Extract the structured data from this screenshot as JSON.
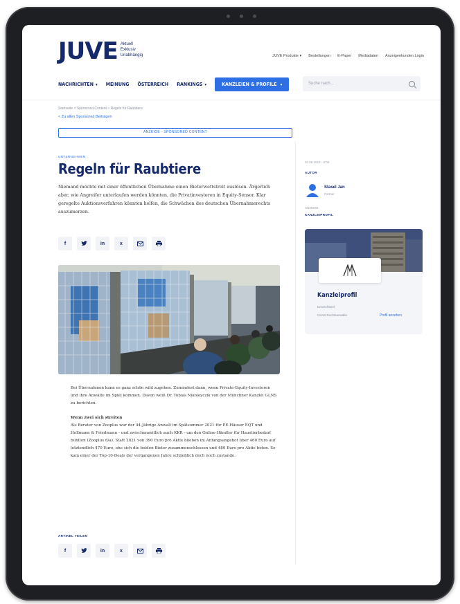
{
  "header": {
    "logo_text": "JUVE",
    "logo_sub": "Aktuell Exklusiv Unabhängig",
    "top_links": [
      "JUVE Produkte ▾",
      "Bestellungen",
      "E-Paper",
      "Mediadaten",
      "Anzeigenkunden Login"
    ],
    "nav": [
      {
        "label": "NACHRICHTEN",
        "has_menu": true
      },
      {
        "label": "MEINUNG",
        "has_menu": false
      },
      {
        "label": "ÖSTERREICH",
        "has_menu": false
      },
      {
        "label": "RANKINGS",
        "has_menu": true
      }
    ],
    "cta_label": "KANZLEIEN & PROFILE",
    "search_placeholder": "Suche nach..."
  },
  "article": {
    "breadcrumb": "Startseite > Sponsored Content > Regeln für Raubtiere",
    "back_link": "< Zu allen Sponsored Beiträgen",
    "sponsored_label": "ANZEIGE - SPONSORED CONTENT",
    "category": "UNTERNEHMEN",
    "title": "Regeln für Raubtiere",
    "lead": "Niemand möchte mit einer öffentlichen Übernahme einen Bieterwettstreit auslösen. Ärgerlich aber, wie Angreifer unterlaufen werden könnten, die Privatinvestoren in Equity-Sensor. Klar geregelte Auktionsverfahren könnten helfen, die Schwächen des deutschen Übernahmerechts auszumerzen.",
    "share_icons": [
      "f",
      "t",
      "in",
      "x",
      "mail",
      "print"
    ],
    "paragraph1": "Bei Übernahmen kann es ganz schön wild zugehen. Zumindest dann, wenn Private-Equity-Investoren und ihre Anwälte im Spiel kommen. Davon weiß Dr. Tobias Nikoleyczik von der Münchner Kanzlei GLNS zu berichten.",
    "subhead": "Wenn zwei sich streiten",
    "paragraph2": "Als Berater von Zooplus war der 44-Jährige Anwalt im Spätsommer 2021 für PE-Häuser EQT und Hellmann & Friedmann - und zwischenzeitlich auch KKR - um den Online-Händler für Haustierbedarf buhlten (Zooplus 6/a). Statt 2021 von 390 Euro pro Aktie blieben im Anfangsangebot über 460 Euro auf letztendlich 470 Euro, ehe sich die beiden Bieter zusammenschlossen und 480 Euro pro Aktie boten. So kam einer der Top-10-Deals der vergangenen Jahre schließlich doch noch zustande.",
    "share_label": "ARTIKEL TEILEN"
  },
  "sidebar": {
    "date": "04.08.2023 - 9:00",
    "author_label": "AUTOR",
    "author_name": "Stasel Jan",
    "author_role": "Partner",
    "misc_label": "ANZEIGE",
    "kanzlei_label": "KANZLEIPROFIL",
    "kanzlei_title": "Kanzleiprofil",
    "kanzlei_line1": "Deutschland",
    "kanzlei_line2": "GLNS Rechtsanwälte",
    "kanzlei_link": "Profil ansehen"
  }
}
